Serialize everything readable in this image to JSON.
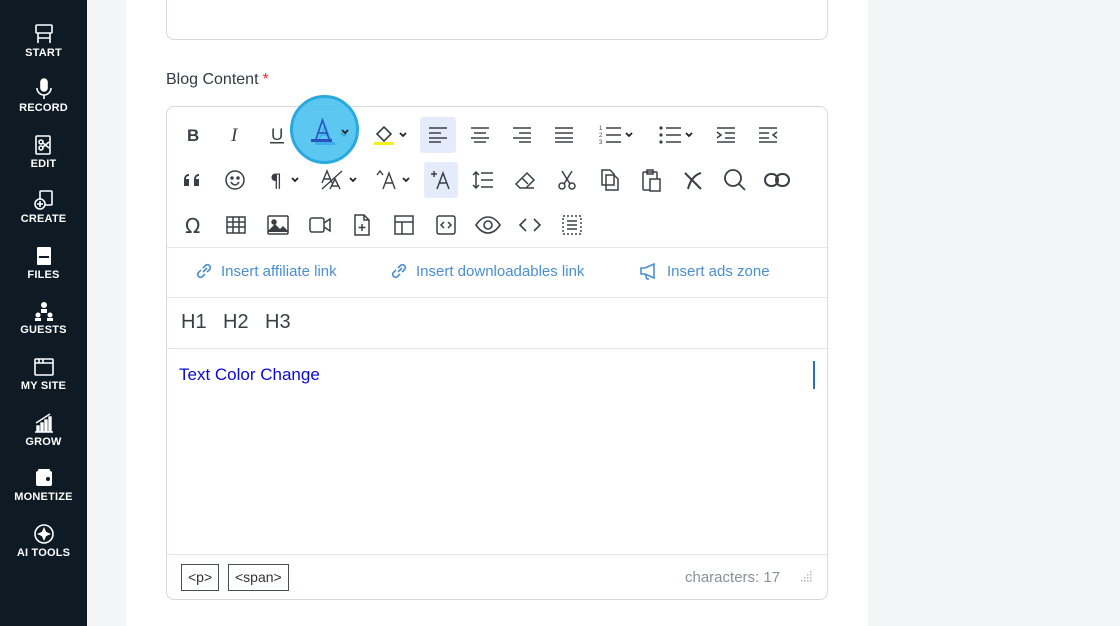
{
  "sidebar": {
    "items": [
      {
        "label": "START",
        "icon": "start-icon"
      },
      {
        "label": "RECORD",
        "icon": "microphone-icon"
      },
      {
        "label": "EDIT",
        "icon": "edit-icon"
      },
      {
        "label": "CREATE",
        "icon": "create-icon"
      },
      {
        "label": "FILES",
        "icon": "files-icon"
      },
      {
        "label": "GUESTS",
        "icon": "guests-icon"
      },
      {
        "label": "MY SITE",
        "icon": "my-site-icon"
      },
      {
        "label": "GROW",
        "icon": "grow-icon"
      },
      {
        "label": "MONETIZE",
        "icon": "monetize-icon"
      },
      {
        "label": "AI TOOLS",
        "icon": "ai-tools-icon"
      }
    ]
  },
  "form": {
    "label": "Blog Content",
    "required_mark": "*"
  },
  "editor": {
    "links": {
      "affiliate": "Insert affiliate link",
      "downloadables": "Insert downloadables link",
      "ads": "Insert ads zone"
    },
    "headings": {
      "h1": "H1",
      "h2": "H2",
      "h3": "H3"
    },
    "content": "Text Color Change",
    "footer": {
      "tag_p": "<p>",
      "tag_span": "<span>",
      "char_count": "characters: 17"
    }
  },
  "colors": {
    "sidebar_bg": "#0e1a24",
    "link": "#4a8fd1",
    "text_color_applied": "#0a0ad0",
    "highlight": "#40bef0",
    "required": "#e0342c"
  }
}
